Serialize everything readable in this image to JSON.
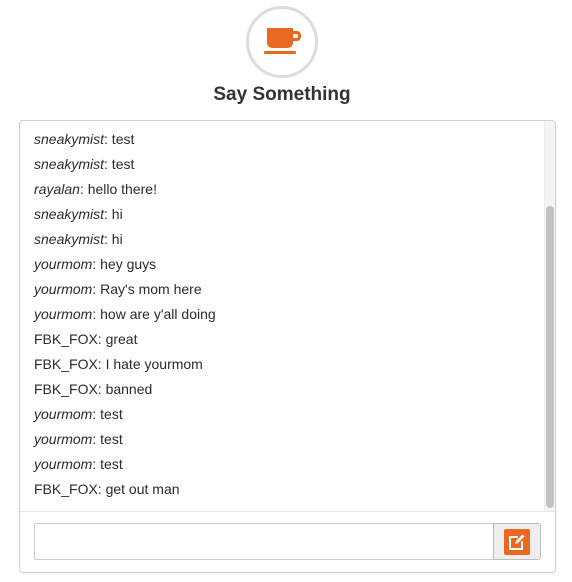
{
  "header": {
    "logo_icon": "coffee-cup-icon",
    "title": "Say Something"
  },
  "colors": {
    "accent": "#e8691f",
    "logo_ring": "#dcdcdc",
    "panel_border": "#cfcfcf",
    "text": "#2b2b2b"
  },
  "chat": {
    "messages": [
      {
        "user": "sneakymist",
        "user_style": "italic",
        "text": ": test"
      },
      {
        "user": "sneakymist",
        "user_style": "italic",
        "text": ": test"
      },
      {
        "user": "rayalan",
        "user_style": "italic",
        "text": ": hello there!"
      },
      {
        "user": "sneakymist",
        "user_style": "italic",
        "text": ": hi"
      },
      {
        "user": "sneakymist",
        "user_style": "italic",
        "text": ": hi"
      },
      {
        "user": "yourmom",
        "user_style": "italic",
        "text": ": hey guys"
      },
      {
        "user": "yourmom",
        "user_style": "italic",
        "text": ": Ray's mom here"
      },
      {
        "user": "yourmom",
        "user_style": "italic",
        "text": ": how are y'all doing"
      },
      {
        "user": "FBK_FOX",
        "user_style": "plain",
        "text": ": great"
      },
      {
        "user": "FBK_FOX",
        "user_style": "plain",
        "text": ": I hate yourmom"
      },
      {
        "user": "FBK_FOX",
        "user_style": "plain",
        "text": ": banned"
      },
      {
        "user": "yourmom",
        "user_style": "italic",
        "text": ": test"
      },
      {
        "user": "yourmom",
        "user_style": "italic",
        "text": ": test"
      },
      {
        "user": "yourmom",
        "user_style": "italic",
        "text": ": test"
      },
      {
        "user": "FBK_FOX",
        "user_style": "plain",
        "text": ": get out man"
      }
    ],
    "input": {
      "value": "",
      "placeholder": ""
    },
    "send_button_icon": "edit-icon"
  }
}
